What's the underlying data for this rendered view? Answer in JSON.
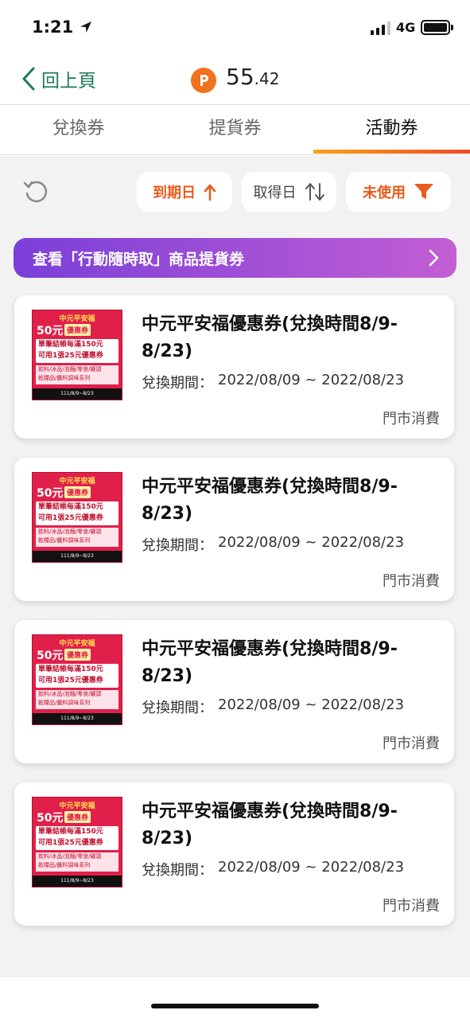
{
  "status_bar": {
    "time": "1:21",
    "network": "4G"
  },
  "header": {
    "back_label": "回上頁",
    "points_main": "55",
    "points_decimal": ".42",
    "points_icon": "P"
  },
  "tabs": [
    {
      "label": "兌換券",
      "active": false
    },
    {
      "label": "提貨券",
      "active": false
    },
    {
      "label": "活動券",
      "active": true
    }
  ],
  "filters": {
    "expiry_label": "到期日",
    "acquired_label": "取得日",
    "status_label": "未使用"
  },
  "banner": {
    "text": "查看「行動隨時取」商品提貨券"
  },
  "coupons": [
    {
      "title": "中元平安福優惠券(兌換時間8/9-8/23)",
      "period_label": "兌換期間：",
      "period": "2022/08/09 ~ 2022/08/23",
      "tag": "門市消費"
    },
    {
      "title": "中元平安福優惠券(兌換時間8/9-8/23)",
      "period_label": "兌換期間：",
      "period": "2022/08/09 ~ 2022/08/23",
      "tag": "門市消費"
    },
    {
      "title": "中元平安福優惠券(兌換時間8/9-8/23)",
      "period_label": "兌換期間：",
      "period": "2022/08/09 ~ 2022/08/23",
      "tag": "門市消費"
    },
    {
      "title": "中元平安福優惠券(兌換時間8/9-8/23)",
      "period_label": "兌換期間：",
      "period": "2022/08/09 ~ 2022/08/23",
      "tag": "門市消費"
    }
  ],
  "coupon_image": {
    "headline": "中元平安福",
    "amount": "50元",
    "badge": "優惠券",
    "line1": "單筆結帳每滿150元",
    "line2": "可用1張25元優惠券",
    "detail1": "飲料/冰品/泡麵/零食/罐頭",
    "detail2": "乾糧品/醬料調味系列",
    "footer": "111/8/9~8/23"
  },
  "colors": {
    "accent": "#ea5b1c",
    "back": "#1e7a5c",
    "banner_start": "#7a3fd8",
    "banner_end": "#c35ed4"
  }
}
